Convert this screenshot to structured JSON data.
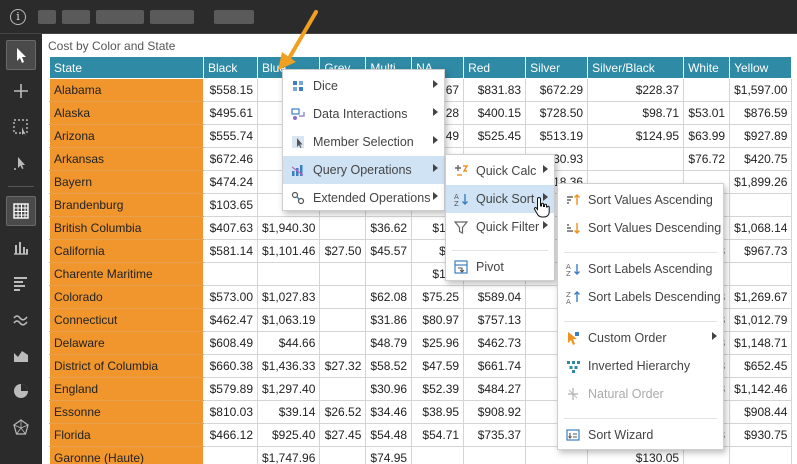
{
  "topbar": {
    "info_glyph": "i"
  },
  "grid": {
    "title": "Cost by Color and State",
    "columns": [
      "State",
      "Black",
      "Blue",
      "Grey",
      "Multi",
      "NA",
      "Red",
      "Silver",
      "Silver/Black",
      "White",
      "Yellow"
    ],
    "rows": [
      [
        "Alabama",
        "$558.15",
        "",
        "",
        "",
        "67",
        "$831.83",
        "$672.29",
        "$228.37",
        "",
        "$1,597.00"
      ],
      [
        "Alaska",
        "$495.61",
        "$1,",
        "",
        "",
        "28",
        "$400.15",
        "$728.50",
        "$98.71",
        "$53.01",
        "$876.59"
      ],
      [
        "Arizona",
        "$555.74",
        "$1,",
        "",
        "",
        "49",
        "$525.45",
        "$513.19",
        "$124.95",
        "$63.99",
        "$927.89"
      ],
      [
        "Arkansas",
        "$672.46",
        "$1,",
        "",
        "",
        "29",
        "",
        "30.93",
        "",
        "$76.72",
        "$420.75"
      ],
      [
        "Bayern",
        "$474.24",
        "$3,",
        "",
        "",
        "",
        "",
        "18.36",
        "",
        "",
        "$1,899.26"
      ],
      [
        "Brandenburg",
        "$103.65",
        "",
        "",
        "",
        "",
        "",
        "",
        "",
        "",
        ""
      ],
      [
        "British Columbia",
        "$407.63",
        "$1,940.30",
        "",
        "$36.62",
        "$105",
        "",
        "",
        "",
        "",
        "$1,068.14"
      ],
      [
        "California",
        "$581.14",
        "$1,101.46",
        "$27.50",
        "$45.57",
        "$66",
        "",
        "",
        "",
        "8",
        "$967.73"
      ],
      [
        "Charente Maritime",
        "",
        "",
        "",
        "",
        "$183",
        "",
        "",
        "",
        "",
        ""
      ],
      [
        "Colorado",
        "$573.00",
        "$1,027.83",
        "",
        "$62.08",
        "$75.25",
        "$589.04",
        "$9",
        "",
        "8",
        "$1,269.67"
      ],
      [
        "Connecticut",
        "$462.47",
        "$1,063.19",
        "",
        "$31.86",
        "$80.97",
        "$757.13",
        "$4",
        "",
        "8",
        "$1,012.79"
      ],
      [
        "Delaware",
        "$608.49",
        "$44.66",
        "",
        "$48.79",
        "$25.96",
        "$462.73",
        "$5",
        "",
        "8",
        "$1,148.71"
      ],
      [
        "District of Columbia",
        "$660.38",
        "$1,436.33",
        "$27.32",
        "$58.52",
        "$47.59",
        "$661.74",
        "$7",
        "",
        "8",
        "$652.45"
      ],
      [
        "England",
        "$579.89",
        "$1,297.40",
        "",
        "$30.96",
        "$52.39",
        "$484.27",
        "$3",
        "",
        "8",
        "$1,142.46"
      ],
      [
        "Essonne",
        "$810.03",
        "$39.14",
        "$26.52",
        "$34.46",
        "$38.95",
        "$908.92",
        "$1,5",
        "",
        "",
        "$908.44"
      ],
      [
        "Florida",
        "$466.12",
        "$925.40",
        "$27.45",
        "$54.48",
        "$54.71",
        "$735.37",
        "$8",
        "",
        "8",
        "$930.75"
      ],
      [
        "Garonne (Haute)",
        "",
        "$1,747.96",
        "",
        "$74.95",
        "",
        "",
        "",
        "$130.05",
        "",
        ""
      ]
    ]
  },
  "menus": {
    "main": [
      {
        "label": "Dice",
        "icon": "dice-icon"
      },
      {
        "label": "Data Interactions",
        "icon": "data-interactions-icon"
      },
      {
        "label": "Member Selection",
        "icon": "member-selection-icon"
      },
      {
        "label": "Query Operations",
        "icon": "query-operations-icon"
      },
      {
        "label": "Extended Operations",
        "icon": "extended-operations-icon"
      }
    ],
    "query": [
      {
        "label": "Quick Calc",
        "icon": "quick-calc-icon"
      },
      {
        "label": "Quick Sort",
        "icon": "quick-sort-icon"
      },
      {
        "label": "Quick Filter",
        "icon": "quick-filter-icon"
      },
      {
        "label": "Pivot",
        "icon": "pivot-icon"
      }
    ],
    "sort": [
      {
        "label": "Sort Values Ascending",
        "icon": "sort-values-ascending-icon"
      },
      {
        "label": "Sort Values Descending",
        "icon": "sort-values-descending-icon"
      },
      {
        "label": "Sort Labels Ascending",
        "icon": "sort-labels-ascending-icon"
      },
      {
        "label": "Sort Labels Descending",
        "icon": "sort-labels-descending-icon"
      },
      {
        "label": "Custom Order",
        "icon": "custom-order-icon"
      },
      {
        "label": "Inverted Hierarchy",
        "icon": "inverted-hierarchy-icon"
      },
      {
        "label": "Natural Order",
        "icon": "natural-order-icon"
      },
      {
        "label": "Sort Wizard",
        "icon": "sort-wizard-icon"
      }
    ]
  },
  "colors": {
    "header_bg": "#2f8aa5",
    "row_header_bg": "#f0962d",
    "highlight": "#cfe3f5",
    "annotation_arrow": "#f0a020"
  }
}
